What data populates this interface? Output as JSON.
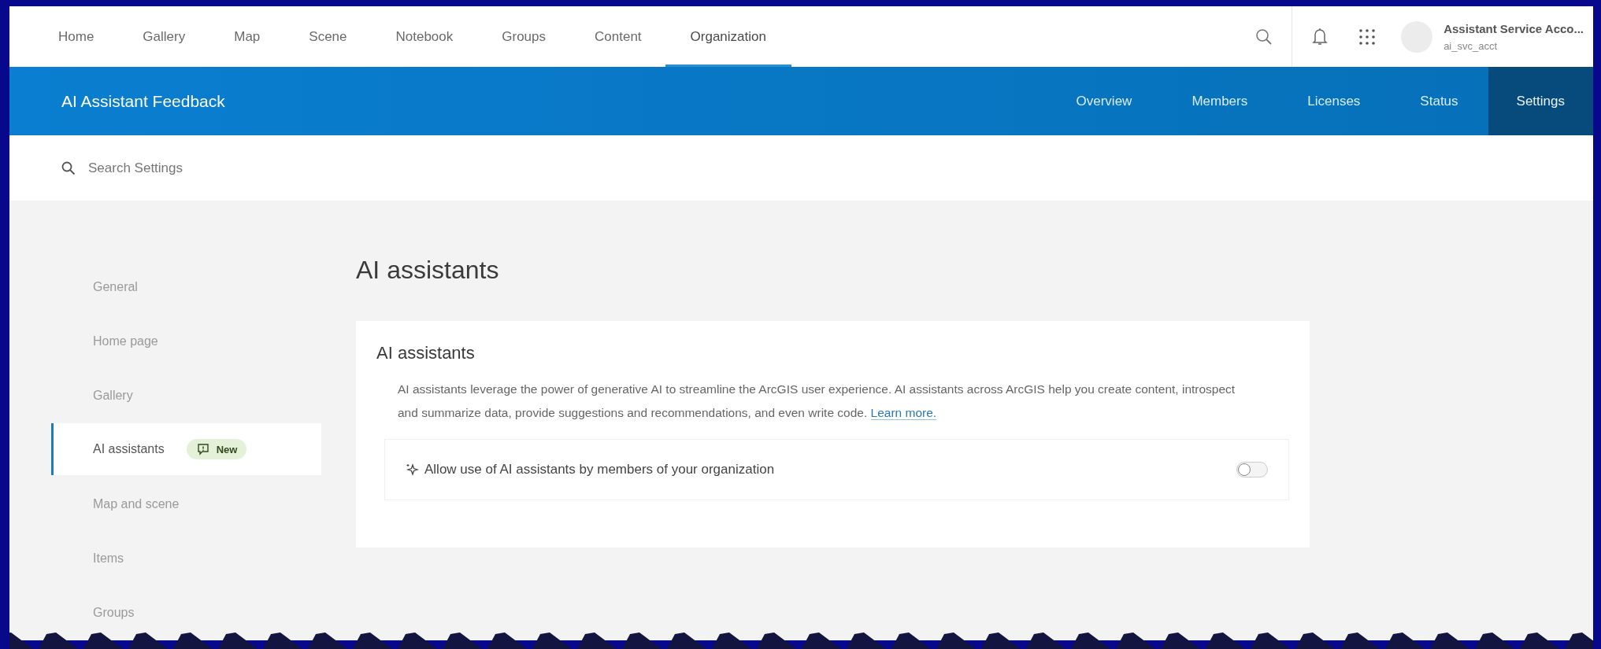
{
  "top_nav": {
    "items": [
      {
        "label": "Home",
        "selected": false
      },
      {
        "label": "Gallery",
        "selected": false
      },
      {
        "label": "Map",
        "selected": false
      },
      {
        "label": "Scene",
        "selected": false
      },
      {
        "label": "Notebook",
        "selected": false
      },
      {
        "label": "Groups",
        "selected": false
      },
      {
        "label": "Content",
        "selected": false
      },
      {
        "label": "Organization",
        "selected": true
      }
    ],
    "user": {
      "name": "Assistant Service Acco...",
      "username": "ai_svc_acct"
    }
  },
  "org_bar": {
    "title": "AI Assistant Feedback",
    "tabs": [
      {
        "label": "Overview",
        "selected": false
      },
      {
        "label": "Members",
        "selected": false
      },
      {
        "label": "Licenses",
        "selected": false
      },
      {
        "label": "Status",
        "selected": false
      },
      {
        "label": "Settings",
        "selected": true
      }
    ]
  },
  "search": {
    "placeholder": "Search Settings"
  },
  "sidebar": {
    "items": [
      {
        "label": "General",
        "selected": false
      },
      {
        "label": "Home page",
        "selected": false
      },
      {
        "label": "Gallery",
        "selected": false
      },
      {
        "label": "AI assistants",
        "selected": true,
        "badge": "New"
      },
      {
        "label": "Map and scene",
        "selected": false
      },
      {
        "label": "Items",
        "selected": false
      },
      {
        "label": "Groups",
        "selected": false
      }
    ]
  },
  "main": {
    "heading": "AI assistants",
    "card": {
      "title": "AI assistants",
      "description": "AI assistants leverage the power of generative AI to streamline the ArcGIS user experience. AI assistants across ArcGIS help you create content, introspect and summarize data, provide suggestions and recommendations, and even write code.",
      "link": "Learn more.",
      "setting": {
        "label": "Allow use of AI assistants by members of your organization",
        "on": false
      }
    }
  }
}
